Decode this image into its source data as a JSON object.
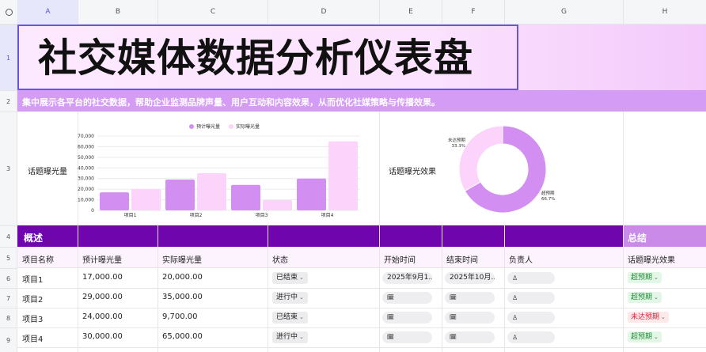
{
  "columns": [
    "A",
    "B",
    "C",
    "D",
    "E",
    "F",
    "G",
    "H"
  ],
  "rows": [
    "1",
    "2",
    "3",
    "4",
    "5",
    "6",
    "7",
    "8",
    "9"
  ],
  "title": "社交媒体数据分析仪表盘",
  "subtitle": "集中展示各平台的社交数据，帮助企业监测品牌声量、用户互动和内容效果，从而优化社媒策略与传播效果。",
  "chart_labels": {
    "bar_cell": "话题曝光量",
    "pie_cell": "话题曝光效果"
  },
  "section": {
    "overview": "概述",
    "summary": "总结"
  },
  "table": {
    "headers": [
      "项目名称",
      "预计曝光量",
      "实际曝光量",
      "状态",
      "开始时间",
      "结束时间",
      "负责人",
      "话题曝光效果"
    ],
    "rows": [
      {
        "name": "项目1",
        "expected": "17,000.00",
        "actual": "20,000.00",
        "status": "已结束",
        "start": "2025年9月1…",
        "end": "2025年10月…",
        "effect": "超预期",
        "effect_kind": "ok"
      },
      {
        "name": "项目2",
        "expected": "29,000.00",
        "actual": "35,000.00",
        "status": "进行中",
        "start": "",
        "end": "",
        "effect": "超预期",
        "effect_kind": "ok"
      },
      {
        "name": "项目3",
        "expected": "24,000.00",
        "actual": "9,700.00",
        "status": "已结束",
        "start": "",
        "end": "",
        "effect": "未达预期",
        "effect_kind": "bad"
      },
      {
        "name": "项目4",
        "expected": "30,000.00",
        "actual": "65,000.00",
        "status": "进行中",
        "start": "",
        "end": "",
        "effect": "超预期",
        "effect_kind": "ok"
      }
    ]
  },
  "chart_data": [
    {
      "type": "bar",
      "categories": [
        "项目1",
        "项目2",
        "项目3",
        "项目4"
      ],
      "series": [
        {
          "name": "预计曝光量",
          "values": [
            17000,
            29000,
            24000,
            30000
          ],
          "color": "#d38ef2"
        },
        {
          "name": "实际曝光量",
          "values": [
            20000,
            35000,
            9700,
            65000
          ],
          "color": "#fbd3fb"
        }
      ],
      "yticks": [
        "0",
        "10,000",
        "20,000",
        "30,000",
        "40,000",
        "50,000",
        "60,000",
        "70,000"
      ],
      "ylim": [
        0,
        70000
      ],
      "legend": "top"
    },
    {
      "type": "pie",
      "donut": true,
      "slices": [
        {
          "label": "超预期",
          "pct": "66.7%",
          "value": 66.7,
          "color": "#d38ef2"
        },
        {
          "label": "未达预期",
          "pct": "33.3%",
          "value": 33.3,
          "color": "#fbd3fb"
        }
      ]
    }
  ],
  "colors": {
    "accent": "#6f06ad",
    "light_purple": "#d49cf5",
    "bar1": "#d38ef2",
    "bar2": "#fbd3fb"
  }
}
